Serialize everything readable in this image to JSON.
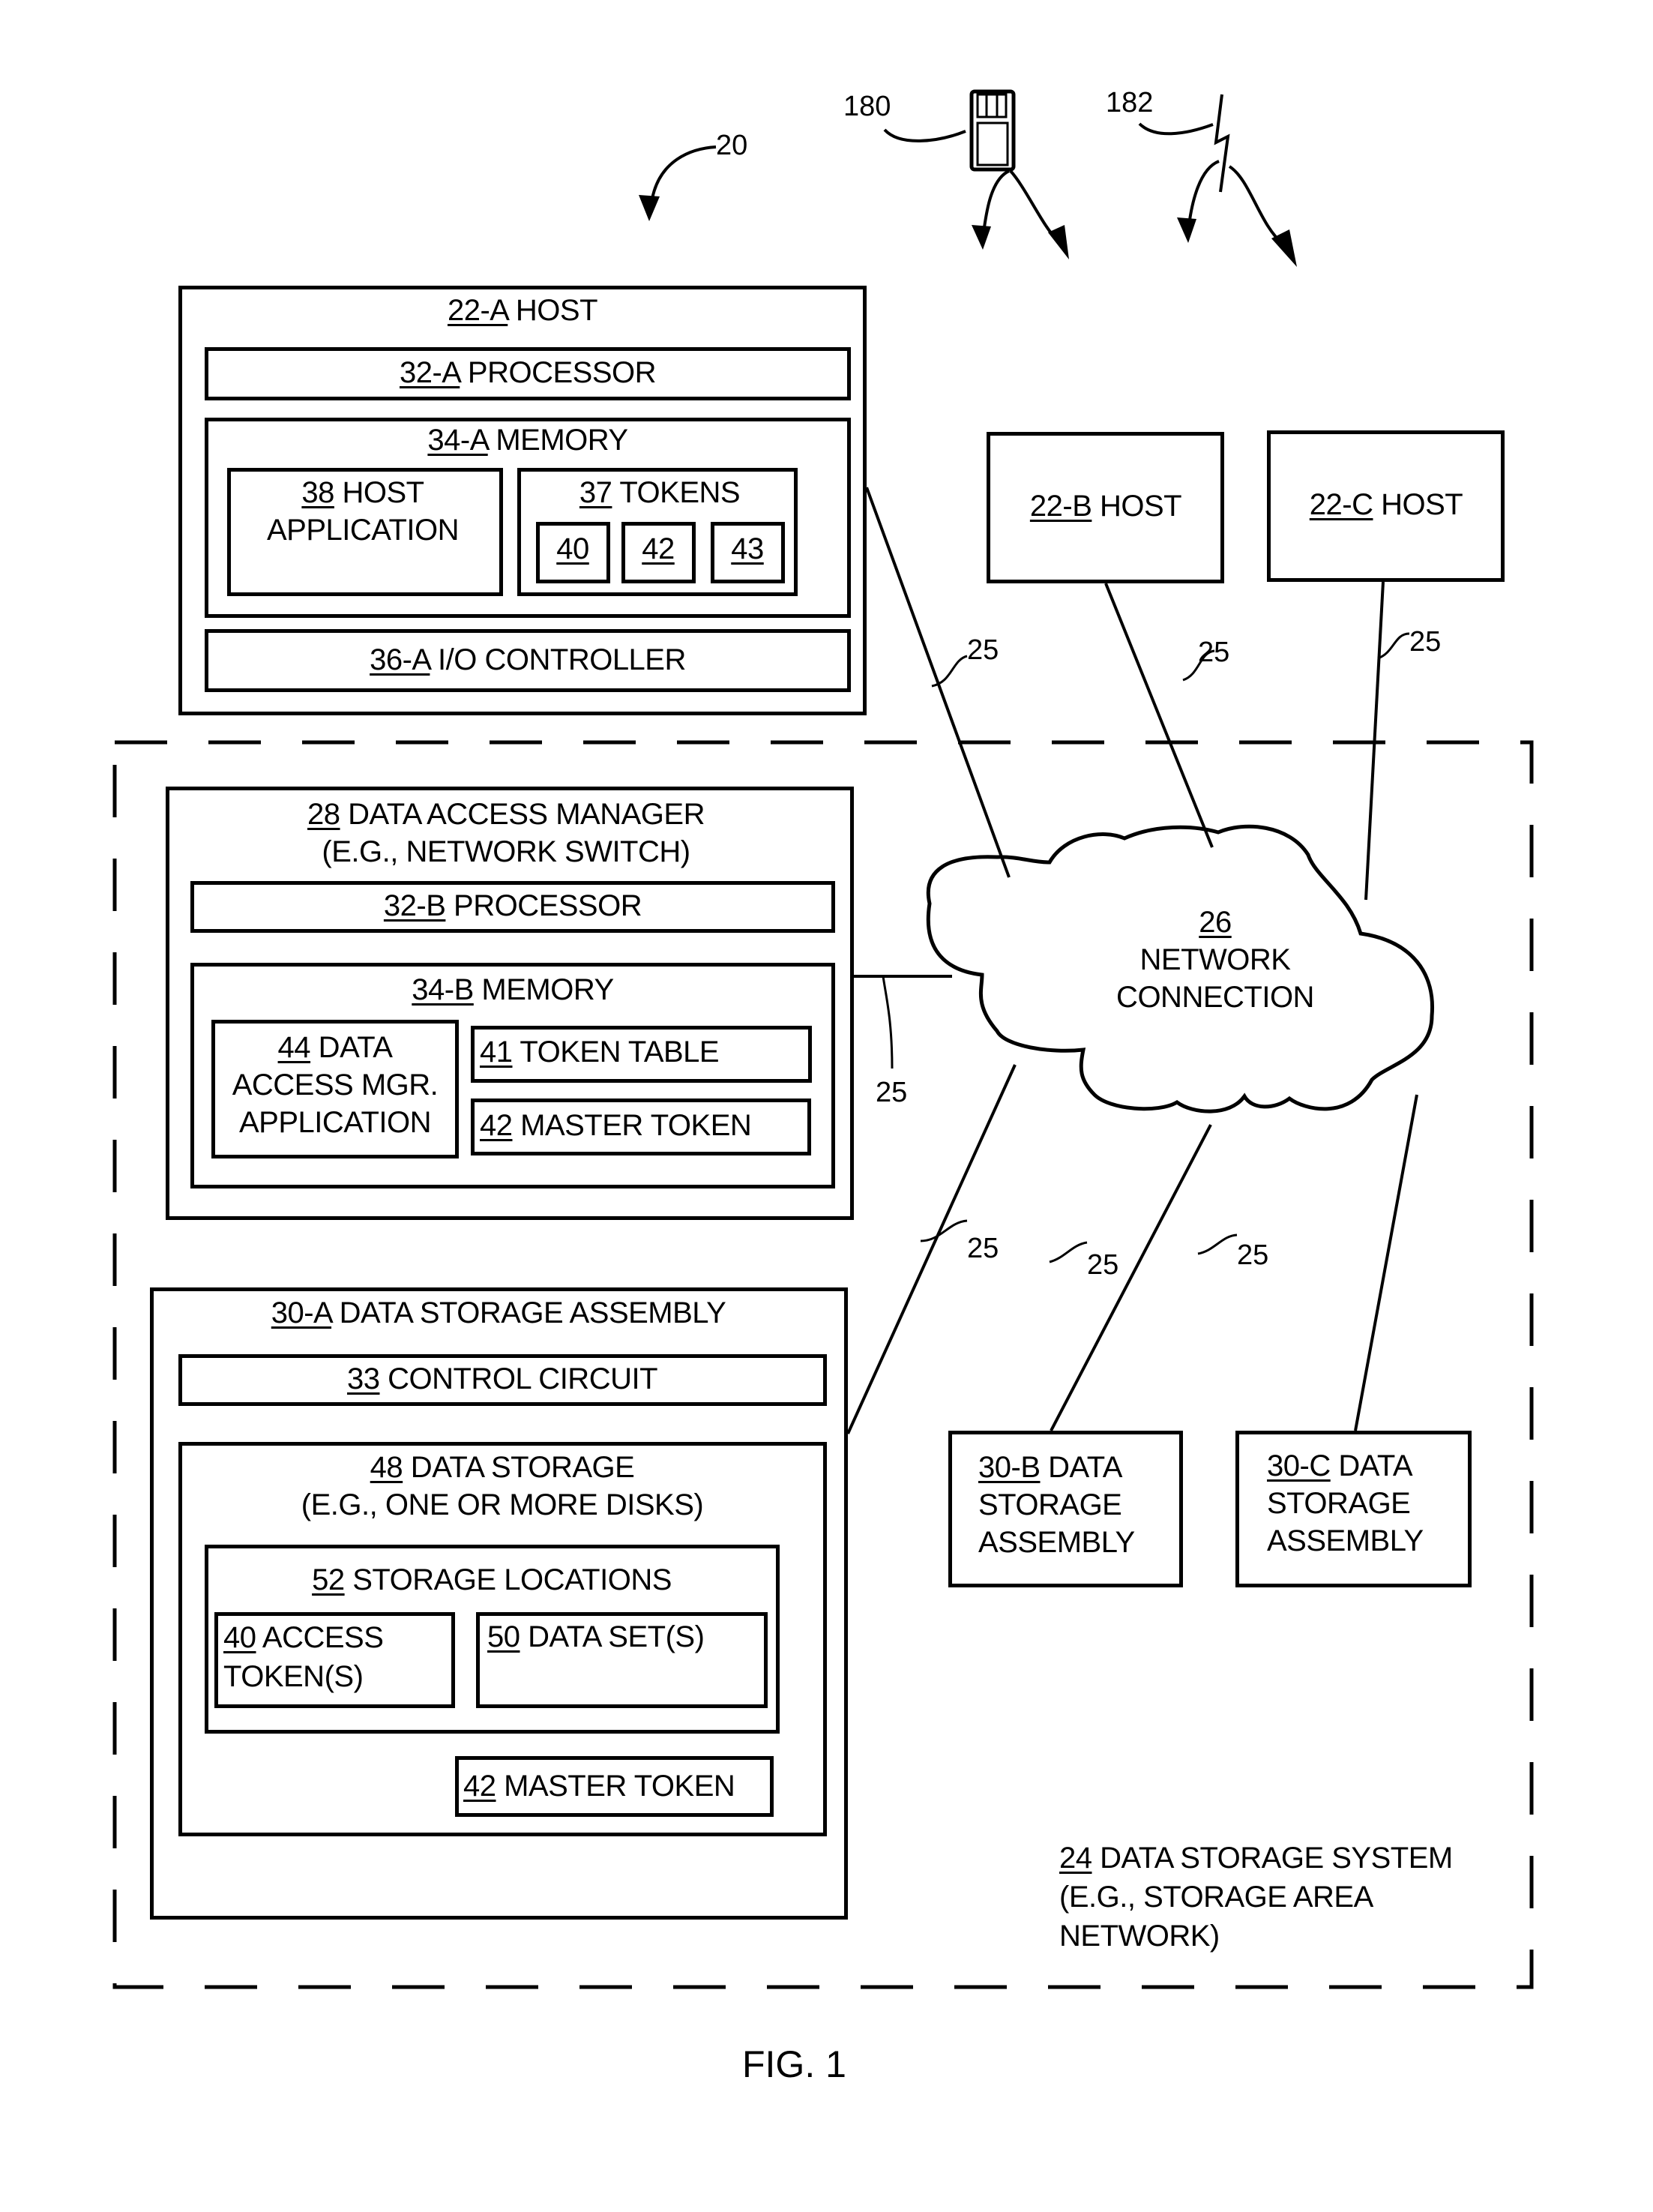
{
  "figure": {
    "caption": "FIG. 1",
    "system_ref": "20",
    "media": [
      {
        "ref": "180",
        "icon": "floppy-disk-icon"
      },
      {
        "ref": "182",
        "icon": "wireless-signal-icon"
      }
    ],
    "connection_ref": "25"
  },
  "host_a": {
    "ref": "22-A",
    "label": "HOST",
    "processor": {
      "ref": "32-A",
      "label": "PROCESSOR"
    },
    "memory": {
      "ref": "34-A",
      "label": "MEMORY",
      "host_application": {
        "ref": "38",
        "line1": "HOST",
        "line2": "APPLICATION"
      },
      "tokens": {
        "ref": "37",
        "label": "TOKENS",
        "items": [
          "40",
          "42",
          "43"
        ]
      }
    },
    "io_controller": {
      "ref": "36-A",
      "label": "I/O CONTROLLER"
    }
  },
  "host_b": {
    "ref": "22-B",
    "label": "HOST"
  },
  "host_c": {
    "ref": "22-C",
    "label": "HOST"
  },
  "network": {
    "ref": "26",
    "line1": "NETWORK",
    "line2": "CONNECTION"
  },
  "data_storage_system": {
    "ref": "24",
    "line1": "DATA STORAGE SYSTEM",
    "line2": "(E.G., STORAGE AREA",
    "line3": "NETWORK)"
  },
  "data_access_manager": {
    "ref": "28",
    "line1": "DATA ACCESS MANAGER",
    "line2": "(E.G., NETWORK SWITCH)",
    "processor": {
      "ref": "32-B",
      "label": "PROCESSOR"
    },
    "memory": {
      "ref": "34-B",
      "label": "MEMORY",
      "app": {
        "ref": "44",
        "line1": "DATA",
        "line2": "ACCESS MGR.",
        "line3": "APPLICATION"
      },
      "token_table": {
        "ref": "41",
        "label": "TOKEN TABLE"
      },
      "master_token": {
        "ref": "42",
        "label": "MASTER TOKEN"
      }
    }
  },
  "dsa_a": {
    "ref": "30-A",
    "label": "DATA STORAGE ASSEMBLY",
    "control_circuit": {
      "ref": "33",
      "label": "CONTROL CIRCUIT"
    },
    "data_storage": {
      "ref": "48",
      "line1": "DATA STORAGE",
      "line2": "(E.G., ONE OR MORE DISKS)",
      "storage_locations": {
        "ref": "52",
        "label": "STORAGE LOCATIONS",
        "access_tokens": {
          "ref": "40",
          "line1": "ACCESS",
          "line2": "TOKEN(S)"
        },
        "data_sets": {
          "ref": "50",
          "label": "DATA SET(S)"
        }
      },
      "master_token": {
        "ref": "42",
        "label": "MASTER TOKEN"
      }
    }
  },
  "dsa_b": {
    "ref": "30-B",
    "line1": "DATA",
    "line2": "STORAGE",
    "line3": "ASSEMBLY"
  },
  "dsa_c": {
    "ref": "30-C",
    "line1": "DATA",
    "line2": "STORAGE",
    "line3": "ASSEMBLY"
  }
}
